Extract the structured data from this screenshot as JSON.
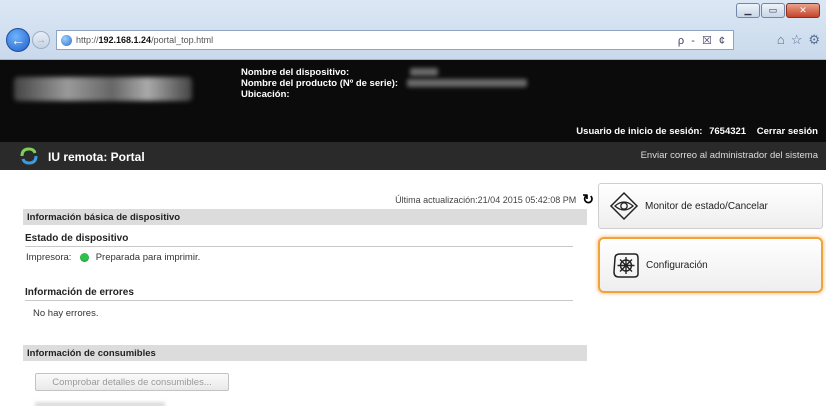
{
  "browser": {
    "url_prefix": "http://",
    "url_host": "192.168.1.24",
    "url_path": "/portal_top.html",
    "addr_tools": "ρ - ☒ ¢",
    "toolbar_icons": [
      "home-icon",
      "star-icon",
      "gear-icon"
    ],
    "window_buttons": [
      "minimize",
      "maximize",
      "close"
    ]
  },
  "header": {
    "device_name_label": "Nombre del dispositivo:",
    "product_name_label": "Nombre del producto (Nº de serie):",
    "location_label": "Ubicación:",
    "login_user_label": "Usuario de inicio de sesión:",
    "login_user_value": "7654321",
    "logout_label": "Cerrar sesión"
  },
  "titlebar": {
    "title": "IU remota: Portal",
    "mail_admin": "Enviar correo al administrador del sistema"
  },
  "main": {
    "last_update": "Última actualización:21/04 2015 05:42:08 PM",
    "basic_info_heading": "Información básica de dispositivo",
    "device_status_title": "Estado de dispositivo",
    "printer_label": "Impresora:",
    "printer_status": "Preparada para imprimir.",
    "error_info_title": "Información de errores",
    "error_text": "No hay errores.",
    "supplies_heading": "Información de consumibles",
    "supplies_button": "Comprobar detalles de consumibles..."
  },
  "side_nav": {
    "status_monitor": "Monitor de estado/Cancelar",
    "settings": "Configuración"
  },
  "colors": {
    "highlight": "#f2a23a",
    "status_ready": "#2fbf4b",
    "header_bg": "#0b0b0b"
  }
}
